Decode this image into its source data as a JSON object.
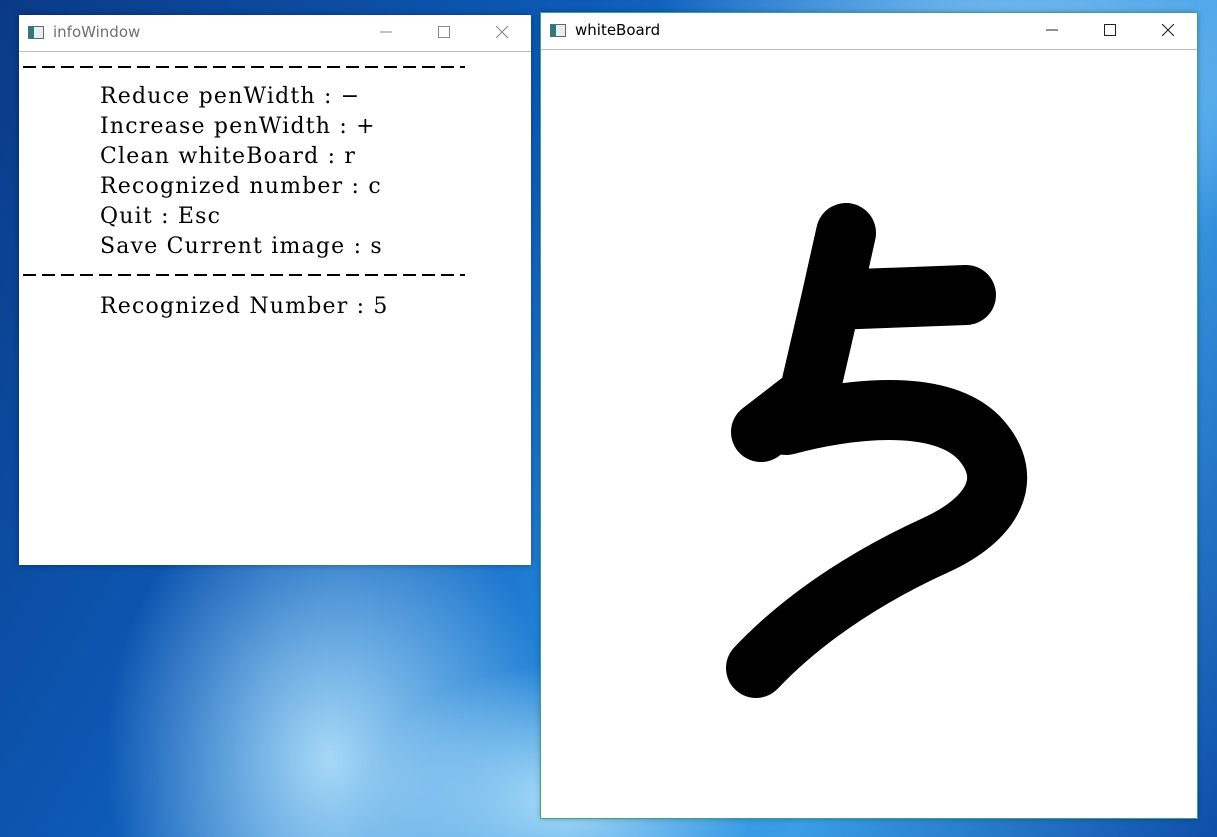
{
  "info_window": {
    "title": "infoWindow",
    "controls": {
      "minimize": "minimize-icon",
      "maximize": "maximize-icon",
      "close": "close-icon"
    },
    "lines": [
      "Reduce penWidth : −",
      "Increase penWidth : +",
      "Clean whiteBoard : r",
      "Recognized number : c",
      "Quit : Esc",
      "Save Current image : s"
    ],
    "result": "Recognized Number : 5"
  },
  "whiteboard_window": {
    "title": "whiteBoard",
    "controls": {
      "minimize": "minimize-icon",
      "maximize": "maximize-icon",
      "close": "close-icon"
    },
    "stroke_color": "#000000",
    "canvas_color": "#ffffff"
  }
}
